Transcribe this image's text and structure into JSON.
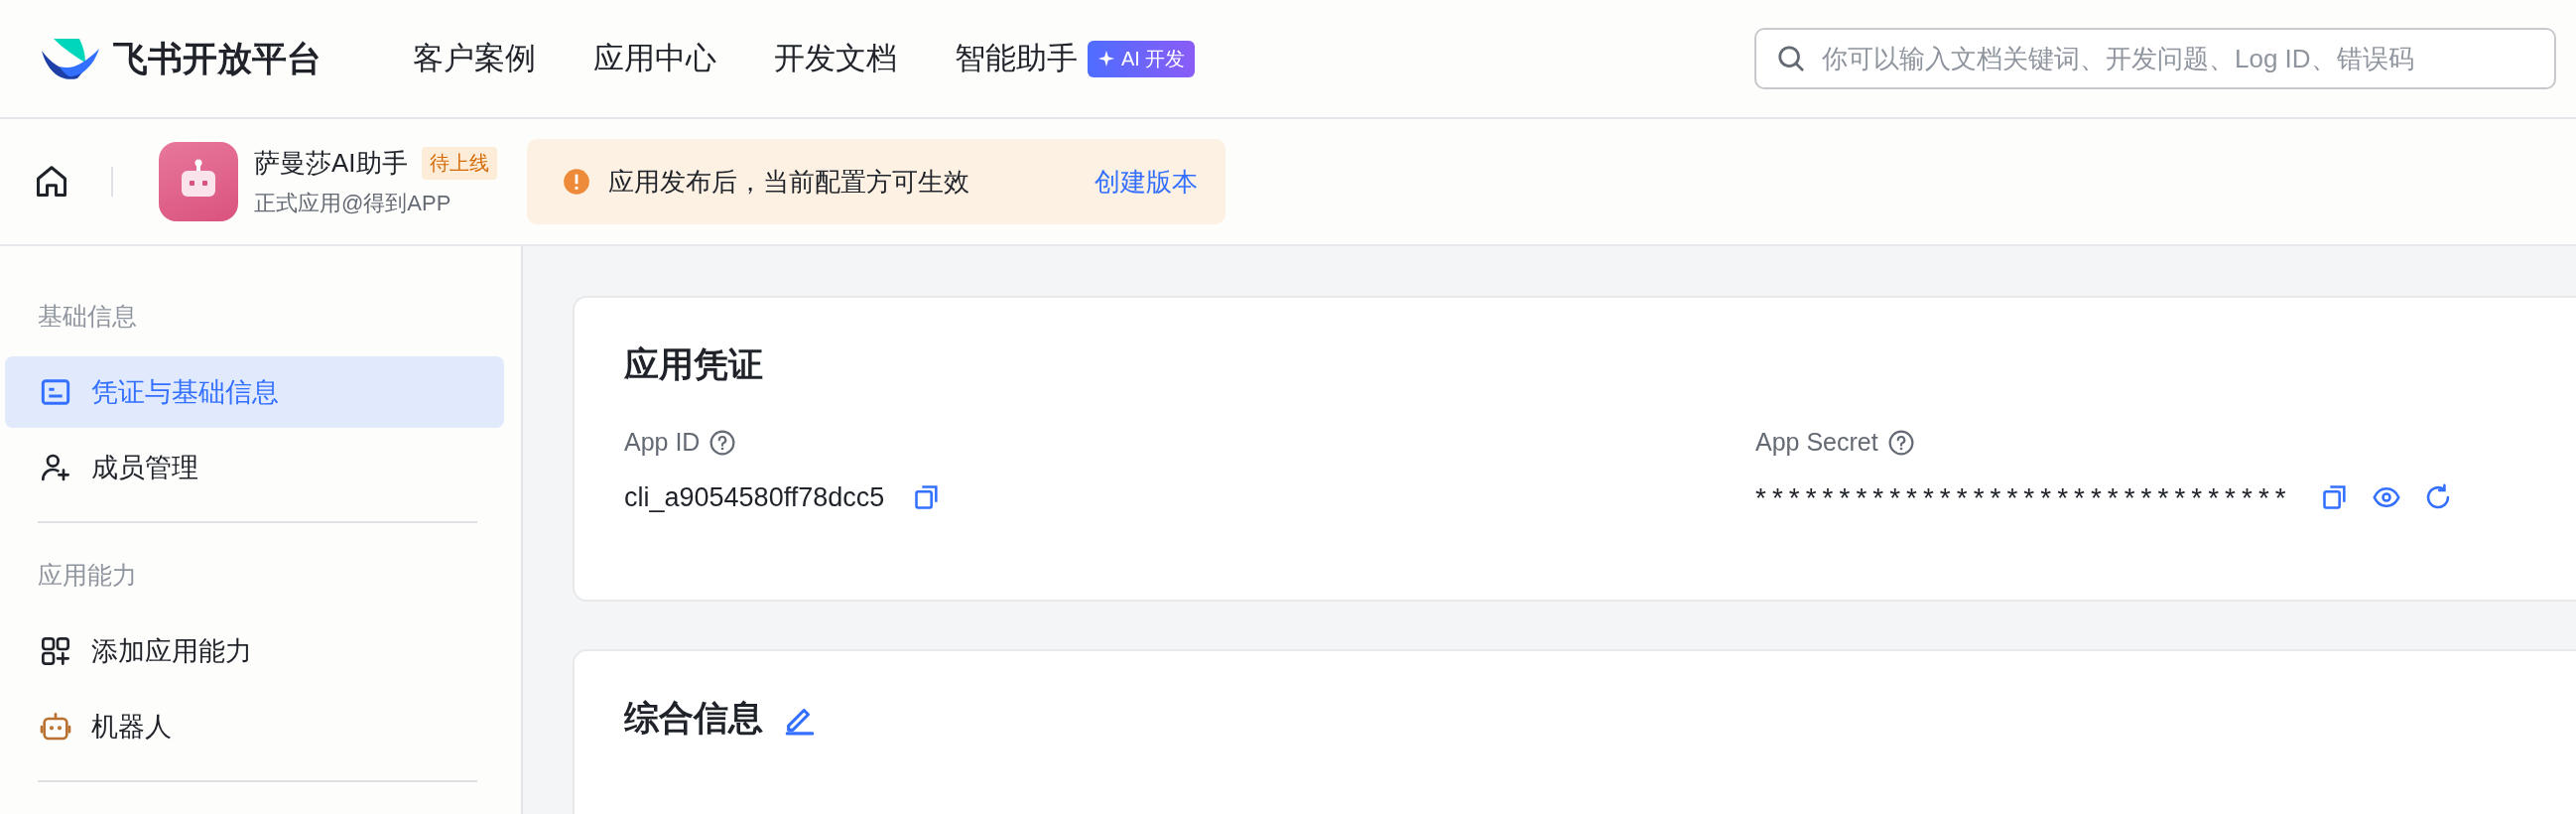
{
  "header": {
    "logo_text": "飞书开放平台",
    "nav": [
      {
        "label": "客户案例"
      },
      {
        "label": "应用中心"
      },
      {
        "label": "开发文档"
      },
      {
        "label": "智能助手",
        "badge": "AI 开发"
      }
    ],
    "search": {
      "placeholder": "你可以输入文档关键词、开发问题、Log ID、错误码"
    }
  },
  "app_bar": {
    "app_name": "萨曼莎AI助手",
    "status_badge": "待上线",
    "subtitle": "正式应用@得到APP",
    "notice": {
      "text": "应用发布后，当前配置方可生效",
      "link": "创建版本"
    }
  },
  "sidebar": {
    "sections": [
      {
        "title": "基础信息",
        "items": [
          {
            "label": "凭证与基础信息",
            "selected": true
          },
          {
            "label": "成员管理",
            "selected": false
          }
        ]
      },
      {
        "title": "应用能力",
        "items": [
          {
            "label": "添加应用能力",
            "selected": false
          },
          {
            "label": "机器人",
            "selected": false
          }
        ]
      }
    ]
  },
  "cards": [
    {
      "title": "应用凭证",
      "fields": [
        {
          "label": "App ID",
          "value": "cli_a9054580ff78dcc5"
        },
        {
          "label": "App Secret",
          "value": "********************************"
        }
      ]
    },
    {
      "title": "综合信息"
    }
  ]
}
